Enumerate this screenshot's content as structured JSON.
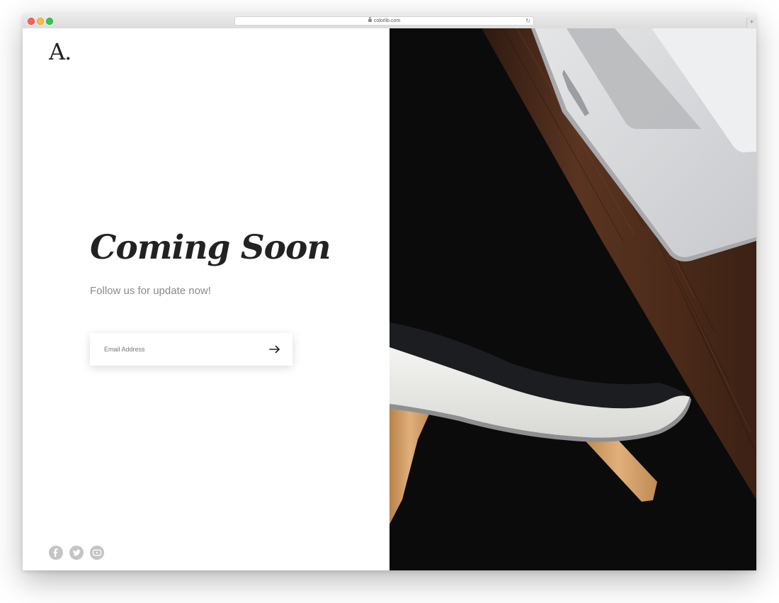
{
  "browser": {
    "url": "colorlib.com",
    "newtab_glyph": "+",
    "reload_glyph": "↻"
  },
  "page": {
    "logo": "A.",
    "headline": "Coming Soon",
    "subheadline": "Follow us for update now!",
    "email": {
      "placeholder": "Email Address",
      "value": ""
    },
    "social": [
      "facebook-icon",
      "twitter-icon",
      "youtube-icon"
    ]
  },
  "colors": {
    "headline": "#222222",
    "subheadline": "#8a8a8a",
    "social_icon": "#c4c4c4",
    "photo_background": "#0b0b0b",
    "wood": "#4a2a18",
    "laptop": "#d9dadc"
  }
}
